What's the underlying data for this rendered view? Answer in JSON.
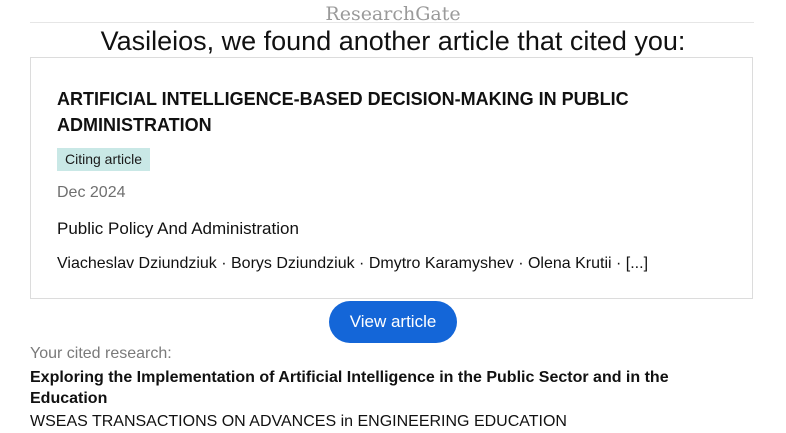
{
  "brand": {
    "name": "ResearchGate"
  },
  "headline": "Vasileios, we found another article that cited you:",
  "article": {
    "title": "ARTIFICIAL INTELLIGENCE-BASED DECISION-MAKING IN PUBLIC ADMINISTRATION",
    "badge": "Citing article",
    "date": "Dec 2024",
    "journal": "Public Policy And Administration",
    "authors": "Viacheslav Dziundziuk · Borys Dziundziuk · Dmytro Karamyshev · Olena Krutii · [...]"
  },
  "actions": {
    "view_article_label": "View article"
  },
  "cited": {
    "label": "Your cited research:",
    "title": "Exploring the Implementation of Artificial Intelligence in the Public Sector and in the Education",
    "journal": "WSEAS TRANSACTIONS ON ADVANCES in ENGINEERING EDUCATION"
  },
  "colors": {
    "accent": "#1466d8",
    "badge_bg": "#c9e8e6",
    "muted_text": "#6f6f6f"
  }
}
